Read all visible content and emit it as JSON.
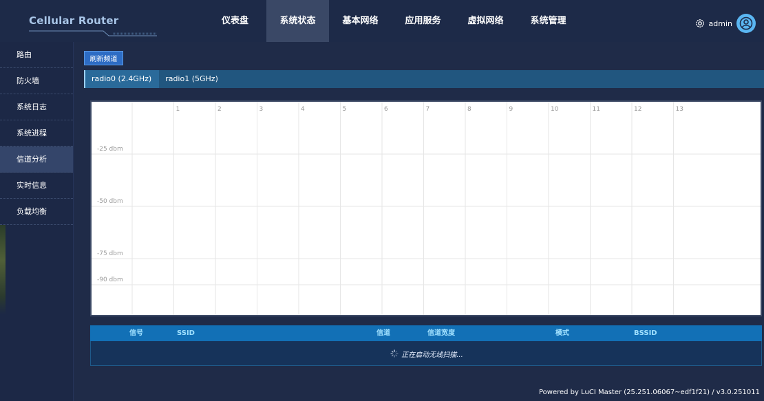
{
  "brand": {
    "title": "Cellular Router"
  },
  "nav": {
    "items": [
      {
        "label": "仪表盘"
      },
      {
        "label": "系统状态"
      },
      {
        "label": "基本网络"
      },
      {
        "label": "应用服务"
      },
      {
        "label": "虚拟网络"
      },
      {
        "label": "系统管理"
      }
    ],
    "active": "系统状态"
  },
  "user": {
    "name": "admin",
    "settings_icon": "gear-icon",
    "avatar_icon": "user-avatar-icon"
  },
  "sidebar": {
    "items": [
      {
        "label": "路由"
      },
      {
        "label": "防火墙"
      },
      {
        "label": "系统日志"
      },
      {
        "label": "系统进程"
      },
      {
        "label": "信道分析"
      },
      {
        "label": "实时信息"
      },
      {
        "label": "负载均衡"
      }
    ],
    "active": "信道分析"
  },
  "toolbar": {
    "refresh_label": "刷新频道"
  },
  "tabs": [
    {
      "label": "radio0 (2.4GHz)"
    },
    {
      "label": "radio1 (5GHz)"
    }
  ],
  "active_tab": "radio0 (2.4GHz)",
  "chart_data": {
    "type": "line",
    "x_ticks": [
      "1",
      "2",
      "3",
      "4",
      "5",
      "6",
      "7",
      "8",
      "9",
      "10",
      "11",
      "12",
      "13"
    ],
    "y_ticks": [
      "-25 dbm",
      "-50 dbm",
      "-75 dbm",
      "-90 dbm"
    ],
    "series": [],
    "grid": true
  },
  "table": {
    "columns": [
      "信号",
      "SSID",
      "信道",
      "信道宽度",
      "模式",
      "BSSID"
    ],
    "status_text": "正在启动无线扫描..."
  },
  "footer": {
    "text": "Powered by LuCI Master (25.251.06067~edf1f21) / v3.0.251011"
  },
  "colors": {
    "background": "#1b2845",
    "topbar": "#1d2a48",
    "active_nav": "#3a4866",
    "accent_blue": "#2d6cc4",
    "table_header": "#1270b6",
    "brand_text": "#a9c6e8"
  }
}
